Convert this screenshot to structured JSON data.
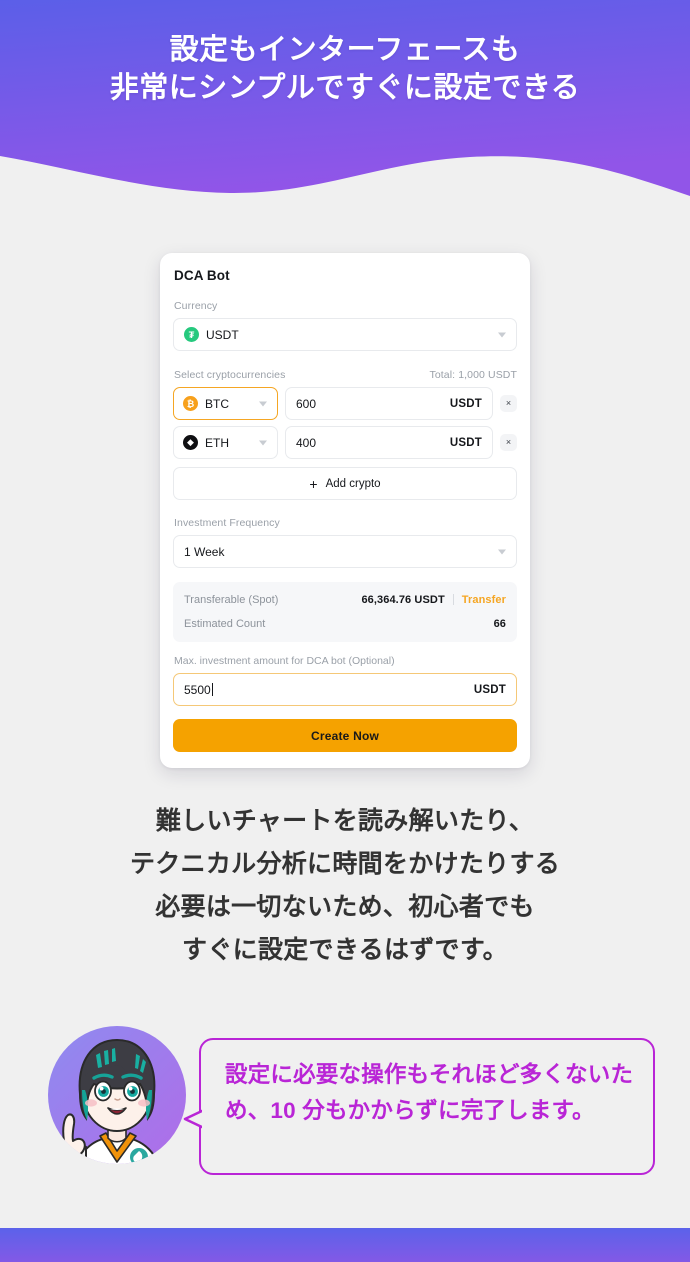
{
  "hero": {
    "title_lines": [
      "設定もインターフェースも",
      "非常にシンプルですぐに設定できる"
    ],
    "gradient_from": "#5B5FE8",
    "gradient_to": "#9155E8"
  },
  "card": {
    "title": "DCA Bot",
    "currency": {
      "label": "Currency",
      "icon": "tether-coin-icon",
      "icon_glyph": "₮",
      "value": "USDT",
      "chevron": "chevron-down-icon"
    },
    "crypto_section": {
      "label": "Select cryptocurrencies",
      "total": "Total: 1,000 USDT",
      "rows": [
        {
          "icon": "bitcoin-coin-icon",
          "icon_glyph": "₿",
          "symbol": "BTC",
          "amount": "600",
          "unit": "USDT",
          "remove_glyph": "×",
          "focused": true
        },
        {
          "icon": "ethereum-coin-icon",
          "icon_glyph": "◆",
          "symbol": "ETH",
          "amount": "400",
          "unit": "USDT",
          "remove_glyph": "×",
          "focused": false
        }
      ],
      "add_label": "Add crypto",
      "add_glyph": "+"
    },
    "frequency": {
      "label": "Investment Frequency",
      "value": "1 Week",
      "chevron": "chevron-down-icon"
    },
    "info": {
      "transferable_label": "Transferable (Spot)",
      "transferable_value": "66,364.76 USDT",
      "transfer_link": "Transfer",
      "estimated_label": "Estimated Count",
      "estimated_value": "66"
    },
    "max": {
      "label": "Max. investment amount for DCA bot (Optional)",
      "value": "5500",
      "unit": "USDT"
    },
    "cta_label": "Create Now",
    "accent_color": "#F5A200"
  },
  "body_copy": {
    "lines": [
      "難しいチャートを読み解いたり、",
      "テクニカル分析に時間をかけたりする",
      "必要は一切ないため、初心者でも",
      "すぐに設定できるはずです。"
    ]
  },
  "character": {
    "name": "mascot-avatar",
    "circle_gradient_from": "#8E8BF0",
    "circle_gradient_to": "#B06CE8"
  },
  "bubble": {
    "text": "設定に必要な操作もそれほど多くないため、10 分もかからずに完了します。",
    "border_color": "#B925D6",
    "text_color": "#B925D6"
  },
  "footer": {
    "gradient_from": "#5B62EA",
    "gradient_to": "#8359E6"
  }
}
